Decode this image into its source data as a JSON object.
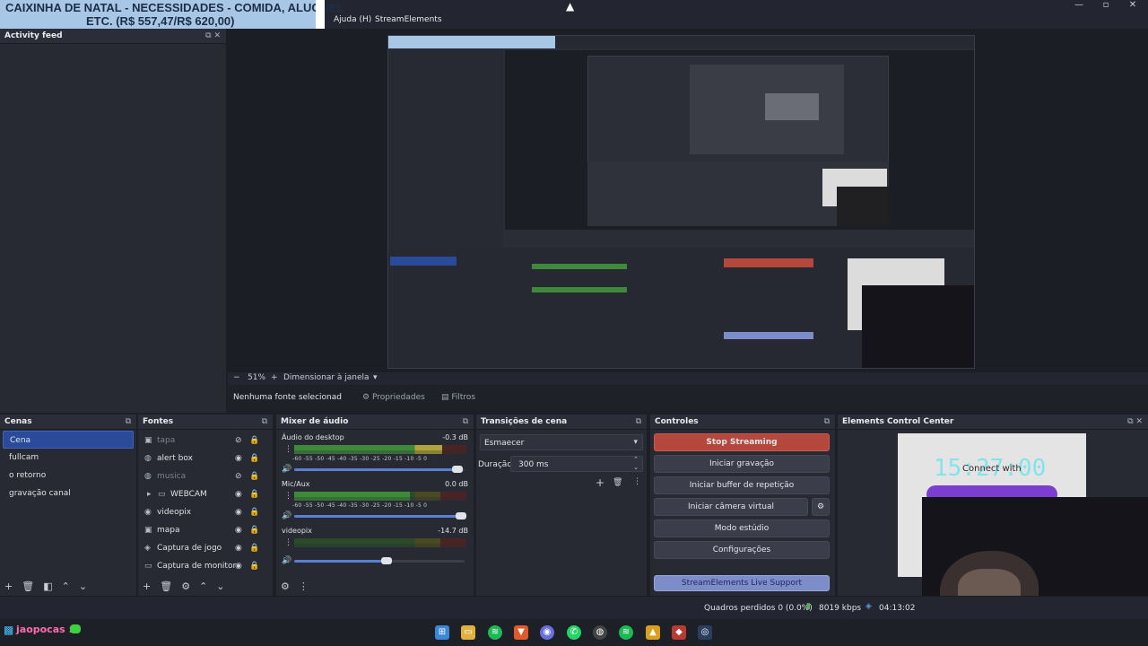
{
  "banner": {
    "line1": "CAIXINHA DE NATAL - NECESSIDADES - COMIDA, ALUGUEL",
    "line2": "ETC. (R$ 557,47/R$ 620,00)"
  },
  "menu": {
    "help": "Ajuda (H)",
    "streamelements": "StreamElements"
  },
  "activity_feed": {
    "title": "Activity feed"
  },
  "preview": {
    "zoom": "51%",
    "resize_label": "Dimensionar à janela"
  },
  "source_toolbar": {
    "no_source": "Nenhuma fonte selecionad",
    "properties": "Propriedades",
    "filters": "Filtros"
  },
  "scenes": {
    "title": "Cenas",
    "items": [
      "Cena",
      "fullcam",
      "o retorno",
      "gravação canal"
    ]
  },
  "sources": {
    "title": "Fontes",
    "items": [
      {
        "name": "tapa",
        "icon": "image-icon",
        "hidden": true
      },
      {
        "name": "alert box",
        "icon": "browser-icon",
        "hidden": false
      },
      {
        "name": "musica",
        "icon": "audio-icon",
        "hidden": true
      },
      {
        "name": "WEBCAM",
        "icon": "folder-icon",
        "hidden": false
      },
      {
        "name": "videopix",
        "icon": "media-icon",
        "hidden": false
      },
      {
        "name": "mapa",
        "icon": "image-icon",
        "hidden": false
      },
      {
        "name": "Captura de jogo",
        "icon": "gamepad-icon",
        "hidden": false
      },
      {
        "name": "Captura de monitor",
        "icon": "monitor-icon",
        "hidden": false
      }
    ]
  },
  "mixer": {
    "title": "Mixer de áudio",
    "scale": "-60 -55 -50 -45 -40 -35 -30 -25 -20 -15 -10 -5 0",
    "channels": [
      {
        "name": "Áudio do desktop",
        "db": "-0.3 dB",
        "level": 0.86,
        "volume": 0.97
      },
      {
        "name": "Mic/Aux",
        "db": "0.0 dB",
        "level": 0.67,
        "volume": 0.99
      },
      {
        "name": "videopix",
        "db": "-14.7 dB",
        "level": 0.0,
        "volume": 0.55
      }
    ]
  },
  "transitions": {
    "title": "Transições de cena",
    "selected": "Esmaecer",
    "duration_label": "Duração",
    "duration_value": "300 ms"
  },
  "controls": {
    "title": "Controles",
    "stop_streaming": "Stop Streaming",
    "start_recording": "Iniciar gravação",
    "replay_buffer": "Iniciar buffer de repetição",
    "virtual_camera": "Iniciar câmera virtual",
    "studio_mode": "Modo estúdio",
    "settings": "Configurações",
    "support": "StreamElements Live Support"
  },
  "ecc": {
    "title": "Elements Control Center",
    "clock": "15:27:00",
    "connect": "Connect with"
  },
  "status": {
    "dropped_frames": "Quadros perdidos 0 (0.0%)",
    "bitrate": "8019 kbps",
    "time": "04:13:02"
  },
  "chat": {
    "user": "jaopocas :"
  },
  "colors": {
    "accent": "#2a4b9a",
    "stop": "#b5483c",
    "meter_green": "#3f8a3a",
    "meter_yellow": "#b3a33c",
    "meter_red": "#a83a3a"
  }
}
